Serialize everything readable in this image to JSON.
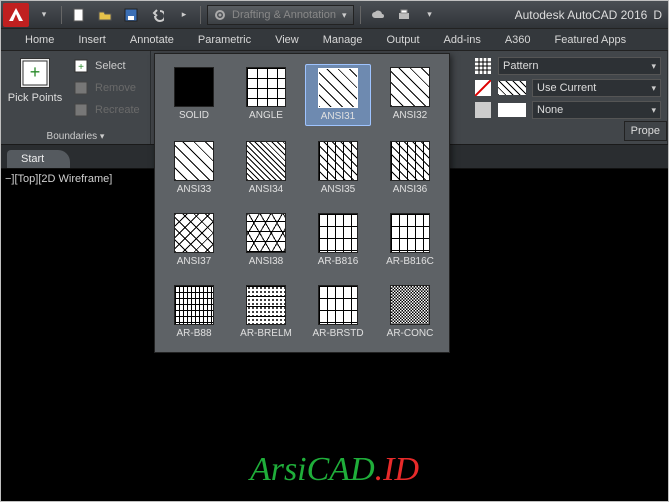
{
  "app": {
    "title_prefix": "Autodesk AutoCAD 2016",
    "title_suffix": "D",
    "workspace": "Drafting & Annotation"
  },
  "ribbon": {
    "tabs": [
      "Home",
      "Insert",
      "Annotate",
      "Parametric",
      "View",
      "Manage",
      "Output",
      "Add-ins",
      "A360",
      "Featured Apps"
    ],
    "boundaries_panel": {
      "pick_points": "Pick Points",
      "select": "Select",
      "remove": "Remove",
      "recreate": "Recreate",
      "title": "Boundaries"
    },
    "pattern_panel": {
      "title": "Pattern"
    },
    "properties_panel": {
      "use_current": "Use Current",
      "none": "None",
      "title": "Prope"
    }
  },
  "patterns": [
    {
      "name": "SOLID",
      "cls": "solid",
      "sel": false
    },
    {
      "name": "ANGLE",
      "cls": "t-angle",
      "sel": false
    },
    {
      "name": "ANSI31",
      "cls": "t-d45",
      "sel": true
    },
    {
      "name": "ANSI32",
      "cls": "t-d45",
      "sel": false
    },
    {
      "name": "ANSI33",
      "cls": "t-d45",
      "sel": false
    },
    {
      "name": "ANSI34",
      "cls": "t-dense45",
      "sel": false
    },
    {
      "name": "ANSI35",
      "cls": "t-mix",
      "sel": false
    },
    {
      "name": "ANSI36",
      "cls": "t-mix",
      "sel": false
    },
    {
      "name": "ANSI37",
      "cls": "t-cross45",
      "sel": false
    },
    {
      "name": "ANSI38",
      "cls": "t-tri",
      "sel": false
    },
    {
      "name": "AR-B816",
      "cls": "t-brick",
      "sel": false
    },
    {
      "name": "AR-B816C",
      "cls": "t-brick",
      "sel": false
    },
    {
      "name": "AR-B88",
      "cls": "t-smallbrick",
      "sel": false
    },
    {
      "name": "AR-BRELM",
      "cls": "t-dots",
      "sel": false
    },
    {
      "name": "AR-BRSTD",
      "cls": "t-brick",
      "sel": false
    },
    {
      "name": "AR-CONC",
      "cls": "t-noise",
      "sel": false
    }
  ],
  "filetabs": {
    "start": "Start"
  },
  "viewport": {
    "label": "−][Top][2D Wireframe]"
  },
  "watermark": {
    "a": "ArsiCAD",
    "b": ".ID"
  }
}
